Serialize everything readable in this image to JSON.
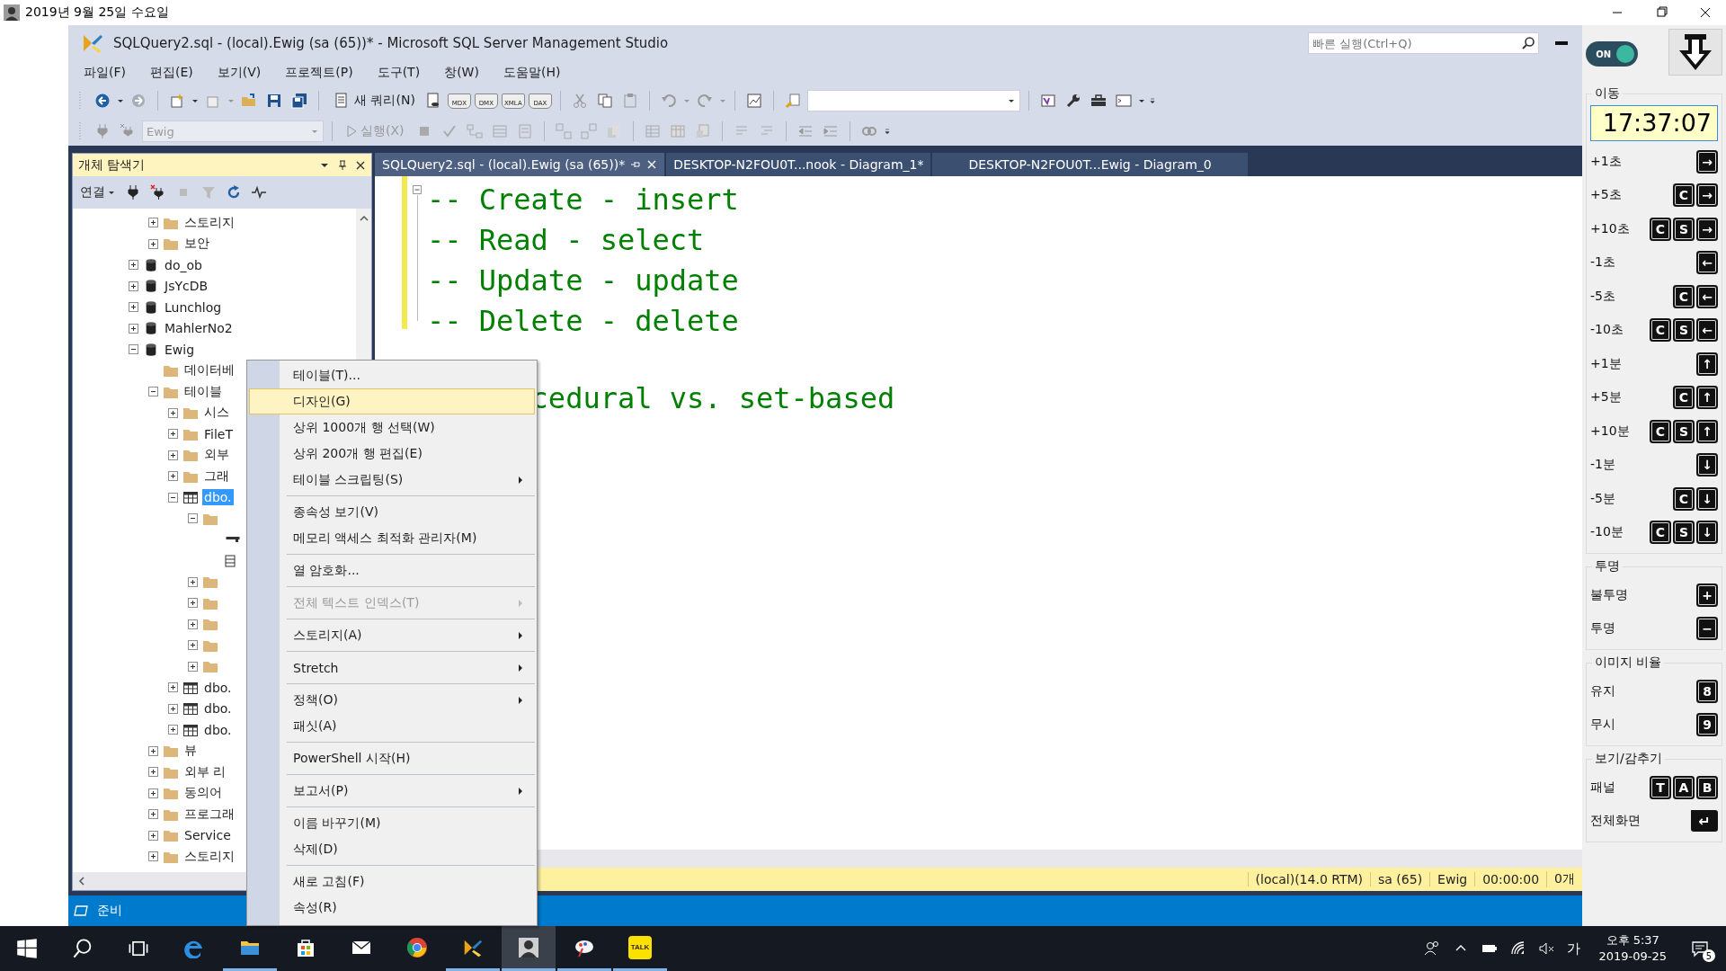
{
  "window": {
    "title": "2019년 9월 25일 수요일"
  },
  "ssms": {
    "title": "SQLQuery2.sql - (local).Ewig (sa (65))* - Microsoft SQL Server Management Studio",
    "quick_launch": {
      "placeholder": "빠른 실행(Ctrl+Q)"
    },
    "menu": [
      "파일(F)",
      "편집(E)",
      "보기(V)",
      "프로젝트(P)",
      "도구(T)",
      "창(W)",
      "도움말(H)"
    ],
    "toolbar_1": {
      "new_query": "새 쿼리(N)",
      "query_types": [
        "MDX",
        "DMX",
        "XMLA",
        "DAX"
      ]
    },
    "toolbar_2": {
      "database": {
        "value": "Ewig",
        "disabled": true
      },
      "execute": {
        "label": "실행(X)",
        "disabled": true
      }
    },
    "object_explorer": {
      "title": "개체 탐색기",
      "connect": "연결",
      "tree": {
        "continued": [
          {
            "label": "스토리지",
            "kind": "folder",
            "expandable": true,
            "expanded": false,
            "selected": false
          },
          {
            "label": "보안",
            "kind": "folder",
            "expandable": true,
            "expanded": false,
            "selected": false
          }
        ],
        "items": [
          {
            "label": "do_ob",
            "kind": "database",
            "expandable": true,
            "expanded": false,
            "selected": false
          },
          {
            "label": "JsYcDB",
            "kind": "database",
            "expandable": true,
            "expanded": false,
            "selected": false
          },
          {
            "label": "Lunchlog",
            "kind": "database",
            "expandable": true,
            "expanded": false,
            "selected": false
          },
          {
            "label": "MahlerNo2",
            "kind": "database",
            "expandable": true,
            "expanded": false,
            "selected": false
          },
          {
            "label": "Ewig",
            "kind": "database",
            "expandable": true,
            "expanded": true,
            "selected": false,
            "children": [
              {
                "label": "데이터베",
                "kind": "folder",
                "selected": false
              },
              {
                "label": "테이블",
                "kind": "folder",
                "expandable": true,
                "expanded": true,
                "selected": false,
                "children": [
                  {
                    "label": "시스",
                    "kind": "folder",
                    "expandable": true,
                    "expanded": false,
                    "selected": false
                  },
                  {
                    "label": "FileT",
                    "kind": "folder",
                    "expandable": true,
                    "expanded": false,
                    "selected": false
                  },
                  {
                    "label": "외부",
                    "kind": "folder",
                    "expandable": true,
                    "expanded": false,
                    "selected": false
                  },
                  {
                    "label": "그래",
                    "kind": "folder",
                    "expandable": true,
                    "expanded": false,
                    "selected": false
                  },
                  {
                    "label": "dbo.",
                    "kind": "table",
                    "expandable": true,
                    "expanded": true,
                    "selected": true,
                    "children": [
                      {
                        "kind": "folder",
                        "expandable": true,
                        "expanded": true,
                        "children": [
                          {
                            "kind": "key_column"
                          },
                          {
                            "kind": "column"
                          }
                        ]
                      },
                      {
                        "kind": "folder",
                        "expandable": true,
                        "expanded": false
                      },
                      {
                        "kind": "folder",
                        "expandable": true,
                        "expanded": false
                      },
                      {
                        "kind": "folder",
                        "expandable": true,
                        "expanded": false
                      },
                      {
                        "kind": "folder",
                        "expandable": true,
                        "expanded": false
                      },
                      {
                        "kind": "folder",
                        "expandable": true,
                        "expanded": false
                      }
                    ]
                  },
                  {
                    "label": "dbo.",
                    "kind": "table",
                    "expandable": true,
                    "expanded": false,
                    "selected": false
                  },
                  {
                    "label": "dbo.",
                    "kind": "table",
                    "expandable": true,
                    "expanded": false,
                    "selected": false
                  },
                  {
                    "label": "dbo.",
                    "kind": "table",
                    "expandable": true,
                    "expanded": false,
                    "selected": false
                  }
                ]
              },
              {
                "label": "뷰",
                "kind": "folder",
                "expandable": true,
                "expanded": false,
                "selected": false
              },
              {
                "label": "외부 리",
                "kind": "folder",
                "expandable": true,
                "expanded": false,
                "selected": false
              },
              {
                "label": "동의어",
                "kind": "folder",
                "expandable": true,
                "expanded": false,
                "selected": false
              },
              {
                "label": "프로그래",
                "kind": "folder",
                "expandable": true,
                "expanded": false,
                "selected": false
              },
              {
                "label": "Service",
                "kind": "folder",
                "expandable": true,
                "expanded": false,
                "selected": false
              },
              {
                "label": "스토리지",
                "kind": "folder",
                "expandable": true,
                "expanded": false,
                "selected": false
              }
            ]
          }
        ]
      }
    },
    "tabs": [
      {
        "label": "SQLQuery2.sql - (local).Ewig (sa (65))*",
        "selected": true
      },
      {
        "label": "DESKTOP-N2FOU0T...nook - Diagram_1*",
        "selected": false
      },
      {
        "label": "DESKTOP-N2FOU0T...Ewig - Diagram_0",
        "selected": false
      }
    ],
    "editor": {
      "lines": [
        {
          "kind": "code",
          "text": "-- Create - insert"
        },
        {
          "kind": "code",
          "text": "-- Read - select"
        },
        {
          "kind": "code",
          "text": "-- Update - update"
        },
        {
          "kind": "code",
          "text": "-- Delete - delete"
        },
        {
          "kind": "blank"
        },
        {
          "kind": "partial",
          "text": "cedural vs. set-based"
        }
      ]
    },
    "query_status": [
      "(local)(14.0 RTM)",
      "sa (65)",
      "Ewig",
      "00:00:00",
      "0개"
    ],
    "status": "준비"
  },
  "context_menu": {
    "groups": [
      [
        {
          "label": "테이블(T)...",
          "selected": false,
          "disabled": false,
          "submenu": false
        },
        {
          "label": "디자인(G)",
          "selected": true,
          "disabled": false,
          "submenu": false
        },
        {
          "label": "상위 1000개 행 선택(W)",
          "selected": false,
          "disabled": false,
          "submenu": false
        },
        {
          "label": "상위 200개 행 편집(E)",
          "selected": false,
          "disabled": false,
          "submenu": false
        },
        {
          "label": "테이블 스크립팅(S)",
          "selected": false,
          "disabled": false,
          "submenu": true
        }
      ],
      [
        {
          "label": "종속성 보기(V)",
          "selected": false,
          "disabled": false,
          "submenu": false
        },
        {
          "label": "메모리 액세스 최적화 관리자(M)",
          "selected": false,
          "disabled": false,
          "submenu": false
        }
      ],
      [
        {
          "label": "열 암호화...",
          "selected": false,
          "disabled": false,
          "submenu": false
        }
      ],
      [
        {
          "label": "전체 텍스트 인덱스(T)",
          "selected": false,
          "disabled": true,
          "submenu": true
        }
      ],
      [
        {
          "label": "스토리지(A)",
          "selected": false,
          "disabled": false,
          "submenu": true
        }
      ],
      [
        {
          "label": "Stretch",
          "selected": false,
          "disabled": false,
          "submenu": true
        }
      ],
      [
        {
          "label": "정책(O)",
          "selected": false,
          "disabled": false,
          "submenu": true
        },
        {
          "label": "패싯(A)",
          "selected": false,
          "disabled": false,
          "submenu": false
        }
      ],
      [
        {
          "label": "PowerShell 시작(H)",
          "selected": false,
          "disabled": false,
          "submenu": false
        }
      ],
      [
        {
          "label": "보고서(P)",
          "selected": false,
          "disabled": false,
          "submenu": true
        }
      ],
      [
        {
          "label": "이름 바꾸기(M)",
          "selected": false,
          "disabled": false,
          "submenu": false
        },
        {
          "label": "삭제(D)",
          "selected": false,
          "disabled": false,
          "submenu": false
        }
      ],
      [
        {
          "label": "새로 고침(F)",
          "selected": false,
          "disabled": false,
          "submenu": false
        },
        {
          "label": "속성(R)",
          "selected": false,
          "disabled": false,
          "submenu": false
        }
      ]
    ]
  },
  "side_panel": {
    "toggle": {
      "label": "ON",
      "on": true
    },
    "groups": [
      {
        "title": "이동",
        "clock": "17:37:07",
        "rows": [
          {
            "label": "+1초",
            "kind": "keys",
            "keys": [
              "→"
            ]
          },
          {
            "label": "+5초",
            "kind": "keys",
            "keys": [
              "C",
              "→"
            ]
          },
          {
            "label": "+10초",
            "kind": "keys",
            "keys": [
              "C",
              "S",
              "→"
            ]
          },
          {
            "label": "-1초",
            "kind": "keys",
            "keys": [
              "←"
            ]
          },
          {
            "label": "-5초",
            "kind": "keys",
            "keys": [
              "C",
              "←"
            ]
          },
          {
            "label": "-10초",
            "kind": "keys",
            "keys": [
              "C",
              "S",
              "←"
            ]
          },
          {
            "label": "+1분",
            "kind": "keys",
            "keys": [
              "↑"
            ]
          },
          {
            "label": "+5분",
            "kind": "keys",
            "keys": [
              "C",
              "↑"
            ]
          },
          {
            "label": "+10분",
            "kind": "keys",
            "keys": [
              "C",
              "S",
              "↑"
            ]
          },
          {
            "label": "-1분",
            "kind": "keys",
            "keys": [
              "↓"
            ]
          },
          {
            "label": "-5분",
            "kind": "keys",
            "keys": [
              "C",
              "↓"
            ]
          },
          {
            "label": "-10분",
            "kind": "keys",
            "keys": [
              "C",
              "S",
              "↓"
            ]
          }
        ]
      },
      {
        "title": "투명",
        "rows": [
          {
            "label": "불투명",
            "kind": "keys",
            "keys": [
              "+"
            ]
          },
          {
            "label": "투명",
            "kind": "keys",
            "keys": [
              "−"
            ]
          }
        ]
      },
      {
        "title": "이미지 비율",
        "rows": [
          {
            "label": "유지",
            "kind": "keys",
            "keys": [
              "8"
            ]
          },
          {
            "label": "무시",
            "kind": "keys",
            "keys": [
              "9"
            ]
          }
        ]
      },
      {
        "title": "보기/감추기",
        "rows": [
          {
            "label": "패널",
            "kind": "keys",
            "keys": [
              "T",
              "A",
              "B"
            ]
          },
          {
            "label": "전체화면",
            "kind": "enter",
            "keys": [
              "↵"
            ]
          }
        ]
      }
    ]
  },
  "taskbar": {
    "apps": [
      {
        "kind": "browser",
        "running": false,
        "selected": false
      },
      {
        "kind": "files",
        "running": true,
        "selected": false
      },
      {
        "kind": "store",
        "running": false,
        "selected": false
      },
      {
        "kind": "mail",
        "running": false,
        "selected": false
      },
      {
        "kind": "chrome",
        "running": false,
        "selected": false
      },
      {
        "kind": "ssms",
        "running": true,
        "selected": false
      },
      {
        "kind": "photo",
        "running": true,
        "selected": true
      },
      {
        "kind": "paint",
        "running": true,
        "selected": false
      },
      {
        "kind": "chat",
        "label": "TALK",
        "running": true,
        "selected": false
      }
    ],
    "ime": "가",
    "time": "오후 5:37",
    "date": "2019-09-25",
    "notifications": "5"
  }
}
